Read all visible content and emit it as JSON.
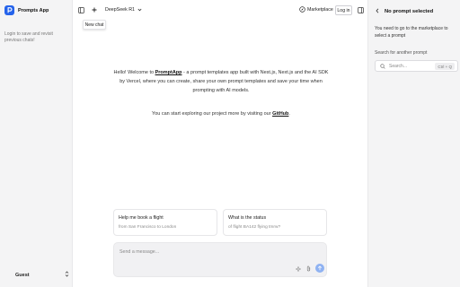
{
  "app": {
    "name": "Prompts App"
  },
  "sidebar": {
    "login_note": "Login to save and revisit previous chats!",
    "user": "Guest"
  },
  "header": {
    "new_chat_tooltip": "New chat",
    "model": "DeepSeek R1",
    "marketplace_label": "Marketplace",
    "login_label": "Log in"
  },
  "welcome": {
    "greeting": "Hello! Welcome to ",
    "brand": "PromptApp",
    "line": " - a prompt templates app built with Nest.js, Next.js and the AI SDK by Vercel, where you can create, share your own prompt templates and save your time when prompting with AI models.",
    "explore_prefix": "You can start exploring our project more by visiting our ",
    "github": "GitHub",
    "explore_suffix": "."
  },
  "suggestions": [
    {
      "title": "Help me book a flight",
      "subtitle": "from San Francisco to London"
    },
    {
      "title": "What is the status",
      "subtitle": "of flight BA142 flying tmrw?"
    }
  ],
  "composer": {
    "placeholder": "Send a message..."
  },
  "panel": {
    "title": "No prompt selected",
    "message": "You need to go to the marketplace to select a prompt",
    "search_label": "Search for another prompt",
    "search_placeholder": "Search...",
    "shortcut": "Ctrl + Q"
  },
  "colors": {
    "accent": "#2563eb",
    "send_button": "#8fb2f2",
    "sidebar_bg": "#f4f4f5"
  }
}
